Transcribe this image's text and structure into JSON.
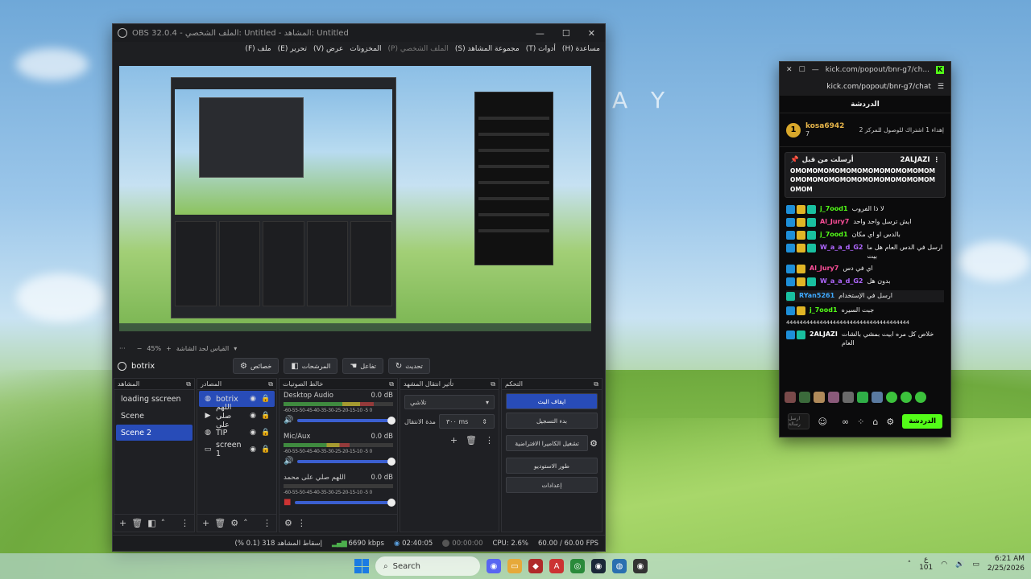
{
  "wallpaper": {
    "text": "A Y"
  },
  "obs": {
    "title": "OBS 32.0.4 - الملف الشخصي: Untitled - المشاهد: Untitled",
    "menu": [
      "ملف (F)",
      "تحرير (E)",
      "عرض (V)",
      "المخزونات",
      "الملف الشخصي (P)",
      "مجموعة المشاهد (S)",
      "أدوات (T)",
      "مساعدة (H)"
    ],
    "zoom": {
      "value": "45%",
      "label": "القياس لحد الشاشة"
    },
    "toolbar": {
      "source_name": "botrix",
      "properties": "خصائص",
      "filters": "المرشحات",
      "interact": "تفاعل",
      "refresh": "تحديث"
    },
    "scenes": {
      "title": "المشاهد",
      "items": [
        "loading sscreen",
        "Scene",
        "Scene 2"
      ],
      "active_index": 2
    },
    "sources": {
      "title": "المصادر",
      "items": [
        {
          "name": "botrix",
          "icon": "globe-icon"
        },
        {
          "name": "اللهم صلي على",
          "icon": "play-icon"
        },
        {
          "name": "TIP",
          "icon": "globe-icon"
        },
        {
          "name": "screen 1",
          "icon": "monitor-icon"
        }
      ]
    },
    "mixer": {
      "title": "خالط الصوتيات",
      "scale": "-60-55-50-45-40-35-30-25-20-15-10 -5 0",
      "channels": [
        {
          "name": "Desktop Audio",
          "db": "0.0 dB",
          "level": 0.82,
          "active": true
        },
        {
          "name": "Mic/Aux",
          "db": "0.0 dB",
          "level": 0.6,
          "active": true
        },
        {
          "name": "اللهم صلي على محمد",
          "db": "0.0 dB",
          "level": 0.0,
          "active": false
        }
      ]
    },
    "transitions": {
      "title": "تأثير انتقال المشهد",
      "selected": "تلاشي",
      "duration_label": "مدة الانتقال",
      "duration_value": "٣٠٠ ms"
    },
    "controls": {
      "title": "التحكم",
      "buttons": [
        "ايقاف البث",
        "بدء التسجيل",
        "تشغيل الكاميرا الافتراضية",
        "طور الاستوديو",
        "إعدادات"
      ]
    },
    "status": {
      "dropped": "إسقاط المشاهد 318 (0.1 %)",
      "bitrate": "6690 kbps",
      "stream_time": "02:40:05",
      "rec_time": "00:00:00",
      "cpu": "CPU: 2.6%",
      "fps": "60.00 / 60.00 FPS"
    }
  },
  "kick": {
    "title": "kick.com/popout/bnr-g7/ch...",
    "url": "kick.com/popout/bnr-g7/chat",
    "header": "الدردشة",
    "top_user": {
      "rank": "1",
      "name": "kosa6942",
      "count": "7",
      "note": "إهداء 1 اشتراك للوصول للمركز 2"
    },
    "pinned": {
      "user": "2ALJAZI",
      "label": "أرسلت من قبل",
      "text": "OMOMOMOMOMOMOMOMOMOMOMOMOMOMOMOMOMOMOMOMOMOMOMOMOMOMOMOM"
    },
    "messages": [
      {
        "user": "j_7ood1",
        "color": "u-green",
        "text": "لا ذا الفروب"
      },
      {
        "user": "Al_Jury7",
        "color": "u-pink",
        "text": "ايش ترسل واحد واحد"
      },
      {
        "user": "j_7ood1",
        "color": "u-green",
        "text": "بالدس او اي مكان"
      },
      {
        "user": "W_a_a_d_G2",
        "color": "u-purple",
        "text": "ارسل في الدس العام هل ما بيت"
      },
      {
        "user": "Al_Jury7",
        "color": "u-pink",
        "text": "اي في دس"
      },
      {
        "user": "W_a_a_d_G2",
        "color": "u-purple",
        "text": "بدون هل"
      },
      {
        "user": "RYan5261",
        "color": "u-blue",
        "text": "ارسل في الإستخدام"
      },
      {
        "user": "j_7ood1",
        "color": "u-green",
        "text": "جبت السيره"
      },
      {
        "user": "",
        "color": "u-white",
        "text": "4444444444444444444444444444444444444"
      },
      {
        "user": "2ALJAZI",
        "color": "u-white",
        "text": "خلاص كل مره ابيت بمشي بالشات العام"
      }
    ],
    "send_label": "الدردشة",
    "input_placeholder": "ارسل رسالة"
  },
  "taskbar": {
    "search": "Search",
    "time": "6:21 AM",
    "date": "2/25/2026",
    "lang": "ع",
    "lang_sub": "101"
  }
}
